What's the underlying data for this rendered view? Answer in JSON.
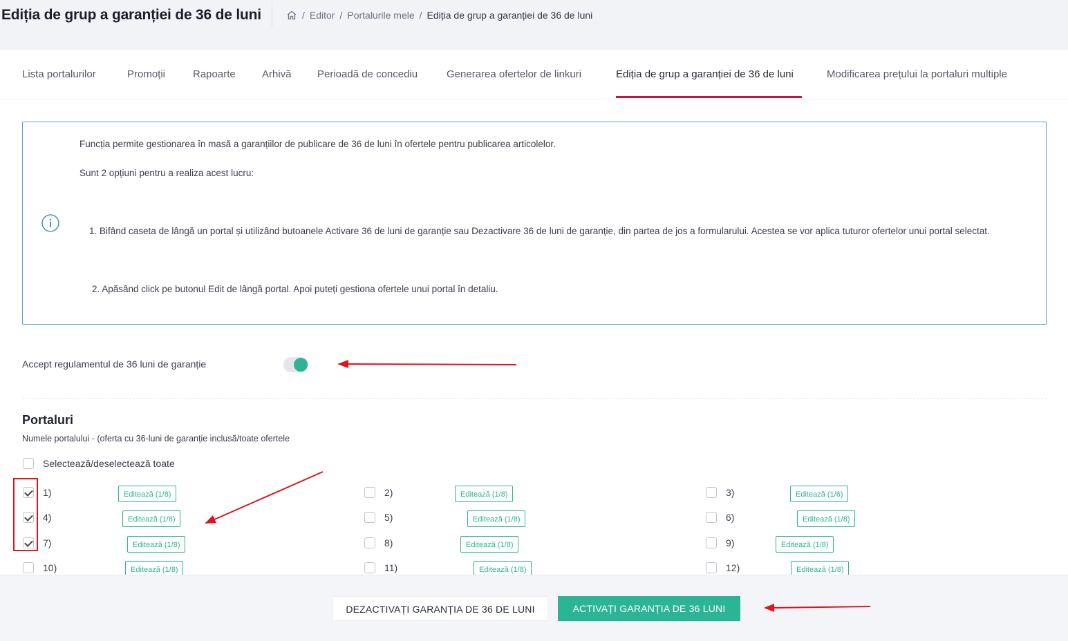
{
  "header": {
    "title": "Ediția de grup a garanției de 36 de luni",
    "breadcrumb": [
      "Editor",
      "Portalurile mele",
      "Ediția de grup a garanției de 36 de luni"
    ]
  },
  "tabs": [
    "Lista portalurilor",
    "Promoții",
    "Rapoarte",
    "Arhivă",
    "Perioadă de concediu",
    "Generarea ofertelor de linkuri",
    "Ediția de grup a garanției de 36 de luni",
    "Modificarea prețului la portaluri multiple"
  ],
  "active_tab": "Ediția de grup a garanției de 36 de luni",
  "info": {
    "p1": "Funcția permite gestionarea în masă a garanțiilor de publicare de 36 de luni în ofertele pentru publicarea articolelor.",
    "p2": "Sunt 2 opțiuni pentru a realiza acest lucru:",
    "p3": "1.  Bifând caseta de lângă un portal și utilizând butoanele Activare 36 de luni de garanție sau Dezactivare 36 de luni de garanție, din partea de jos a formularului. Acestea se vor aplica tuturor ofertelor unui portal selectat.",
    "p4": "2. Apăsând click pe butonul Edit de lângă portal. Apoi puteți gestiona ofertele unui portal în detaliu."
  },
  "accept": {
    "label": "Accept regulamentul de 36 luni de garanție",
    "enabled": true
  },
  "portals": {
    "title": "Portaluri",
    "subtitle": "Numele portalului - (oferta cu 36-luni de garanție inclusă/toate ofertele",
    "select_all": "Selectează/deselectează toate",
    "items": [
      {
        "label": "1)",
        "checked": true,
        "edit": "Editează (1/8)"
      },
      {
        "label": "2)",
        "checked": false,
        "edit": "Editează (1/8)"
      },
      {
        "label": "3)",
        "checked": false,
        "edit": "Editează (1/6)"
      },
      {
        "label": "4)",
        "checked": true,
        "edit": "Editează (1/8)"
      },
      {
        "label": "5)",
        "checked": false,
        "edit": "Editează (1/8)"
      },
      {
        "label": "6)",
        "checked": false,
        "edit": "Editează (1/8)"
      },
      {
        "label": "7)",
        "checked": true,
        "edit": "Editează (1/8)"
      },
      {
        "label": "8)",
        "checked": false,
        "edit": "Editează (1/8)"
      },
      {
        "label": "9)",
        "checked": false,
        "edit": "Editează (1/8)"
      },
      {
        "label": "10)",
        "checked": false,
        "edit": "Editează (1/8)"
      },
      {
        "label": "11)",
        "checked": false,
        "edit": "Editează (1/8)"
      },
      {
        "label": "12)",
        "checked": false,
        "edit": "Editează (1/8)"
      }
    ]
  },
  "actions": {
    "deactivate": "DEZACTIVAȚI GARANȚIA DE 36 DE LUNI",
    "activate": "ACTIVAȚI GARANȚIA DE 36 LUNI"
  },
  "colors": {
    "accent": "#2bb594",
    "tab_active": "#c4163c",
    "info_border": "#5b9bd5",
    "annotation": "#e0141d"
  }
}
